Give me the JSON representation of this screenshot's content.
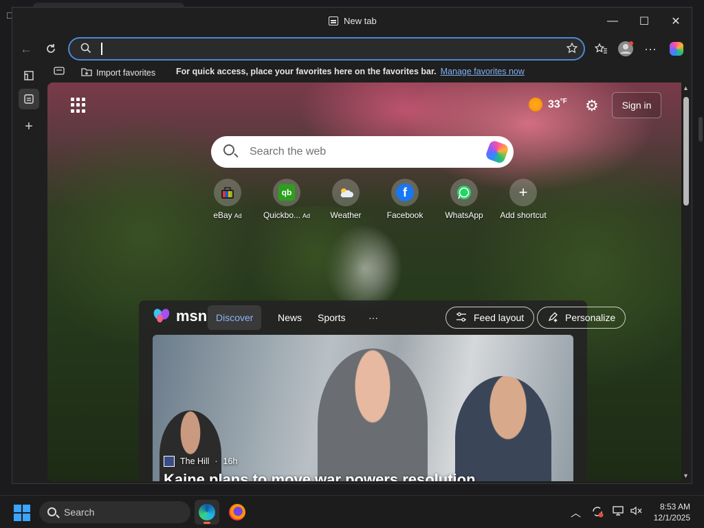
{
  "window": {
    "title": "New tab",
    "controls": {
      "minimize": "—",
      "maximize": "☐",
      "close": "✕"
    }
  },
  "address_bar": {
    "value": "",
    "placeholder": ""
  },
  "favorites_bar": {
    "import_label": "Import favorites",
    "hint": "For quick access, place your favorites here on the favorites bar.",
    "manage_link": "Manage favorites now"
  },
  "newtab": {
    "weather": {
      "temperature": "33",
      "unit": "°F"
    },
    "sign_in": "Sign in",
    "search_placeholder": "Search the web",
    "shortcuts": [
      {
        "label": "eBay",
        "ad": "Ad",
        "icon": "ebay-icon"
      },
      {
        "label": "Quickbo...",
        "ad": "Ad",
        "icon": "quickbooks-icon"
      },
      {
        "label": "Weather",
        "ad": "",
        "icon": "weather-icon"
      },
      {
        "label": "Facebook",
        "ad": "",
        "icon": "facebook-icon"
      },
      {
        "label": "WhatsApp",
        "ad": "",
        "icon": "whatsapp-icon"
      },
      {
        "label": "Add shortcut",
        "ad": "",
        "icon": "plus-icon"
      }
    ]
  },
  "feed": {
    "brand": "msn",
    "tabs": [
      "Discover",
      "News",
      "Sports",
      "···"
    ],
    "active_tab": "Discover",
    "feed_layout": "Feed layout",
    "personalize": "Personalize",
    "card": {
      "source": "The Hill",
      "age": "16h",
      "headline": "Kaine plans to move war powers resolution"
    }
  },
  "taskbar": {
    "search_label": "Search",
    "time": "8:53 AM",
    "date": "12/1/2025"
  },
  "colors": {
    "accent": "#4a8ad8",
    "link": "#7fb0f2",
    "windows_blue": "#3ca3ff"
  }
}
